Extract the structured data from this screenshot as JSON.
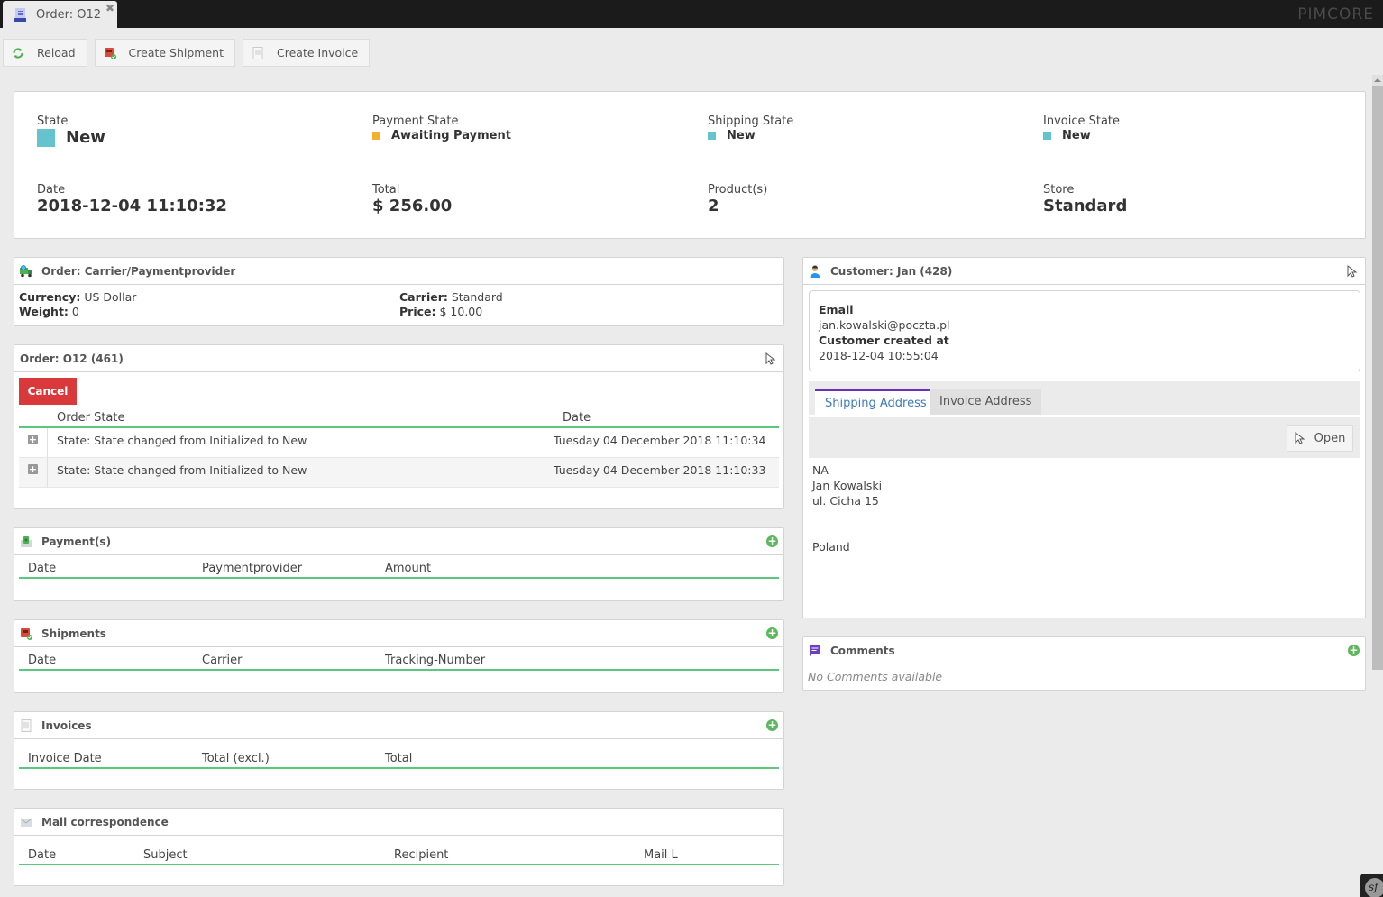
{
  "window": {
    "tab_title": "Order: O12",
    "tab_icon": "order-list-icon",
    "close_glyph": "✖",
    "brand": "PIMCORE"
  },
  "toolbar": {
    "reload_label": "Reload",
    "create_shipment_label": "Create Shipment",
    "create_invoice_label": "Create Invoice"
  },
  "summary": {
    "state_label": "State",
    "state_value": "New",
    "state_color": "#64c3cc",
    "payment_state_label": "Payment State",
    "payment_state_value": "Awaiting Payment",
    "payment_state_color": "#f6b12c",
    "shipping_state_label": "Shipping State",
    "shipping_state_value": "New",
    "shipping_state_color": "#64c3cc",
    "invoice_state_label": "Invoice State",
    "invoice_state_value": "New",
    "invoice_state_color": "#64c3cc",
    "date_label": "Date",
    "date_value": "2018-12-04 11:10:32",
    "total_label": "Total",
    "total_value": "$ 256.00",
    "products_label": "Product(s)",
    "products_value": "2",
    "store_label": "Store",
    "store_value": "Standard"
  },
  "carrier_panel": {
    "title": "Order: Carrier/Paymentprovider",
    "currency_label": "Currency:",
    "currency_value": "US Dollar",
    "weight_label": "Weight:",
    "weight_value": "0",
    "carrier_label": "Carrier:",
    "carrier_value": "Standard",
    "price_label": "Price:",
    "price_value": "$ 10.00"
  },
  "order_panel": {
    "title": "Order: O12 (461)",
    "cancel_label": "Cancel",
    "columns": [
      "Order State",
      "Date"
    ],
    "rows": [
      {
        "state": "State: State changed from Initialized to New",
        "date": "Tuesday 04 December 2018 11:10:34"
      },
      {
        "state": "State: State changed from Initialized to New",
        "date": "Tuesday 04 December 2018 11:10:33"
      }
    ]
  },
  "payments_panel": {
    "title": "Payment(s)",
    "columns": [
      "Date",
      "Paymentprovider",
      "Amount"
    ]
  },
  "shipments_panel": {
    "title": "Shipments",
    "columns": [
      "Date",
      "Carrier",
      "Tracking-Number"
    ]
  },
  "invoices_panel": {
    "title": "Invoices",
    "columns": [
      "Invoice Date",
      "Total (excl.)",
      "Total"
    ]
  },
  "mail_panel": {
    "title": "Mail correspondence",
    "columns": [
      "Date",
      "Subject",
      "Recipient",
      "Mail L"
    ]
  },
  "customer_panel": {
    "title": "Customer: Jan (428)",
    "email_label": "Email",
    "email_value": "jan.kowalski@poczta.pl",
    "created_label": "Customer created at",
    "created_value": "2018-12-04 10:55:04",
    "tabs": [
      "Shipping Address",
      "Invoice Address"
    ],
    "active_tab": "Shipping Address",
    "open_label": "Open",
    "address_lines": [
      "NA",
      "Jan Kowalski",
      "ul. Cicha 15",
      "",
      "",
      "Poland"
    ]
  },
  "comments_panel": {
    "title": "Comments",
    "empty_text": "No Comments available"
  }
}
